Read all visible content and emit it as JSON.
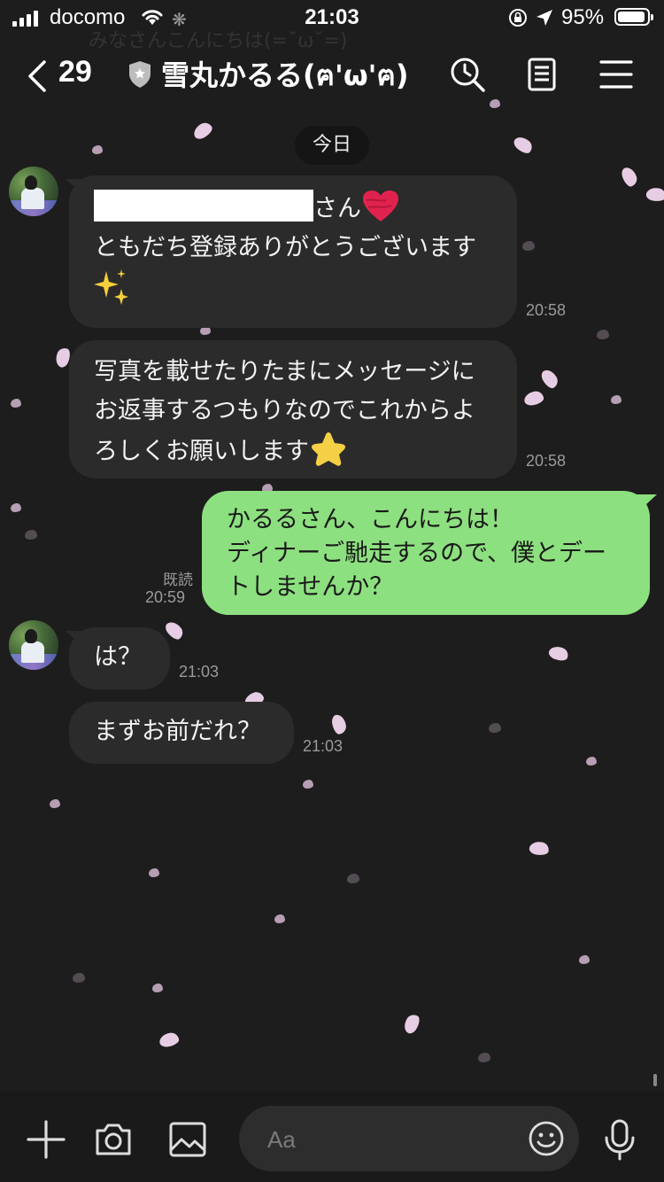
{
  "status_bar": {
    "carrier": "docomo",
    "time": "21:03",
    "battery_percent": "95%",
    "battery_level": 0.95
  },
  "ghost_notification": "みなさんこんにちは(=˘ω˘=)",
  "header": {
    "back_count": "29",
    "title": "雪丸かるる(ฅ'ω'ฅ)",
    "icons": [
      "shield-icon",
      "history-search-icon",
      "notes-icon",
      "menu-icon"
    ]
  },
  "date_label": "今日",
  "messages": [
    {
      "from": "them",
      "line1_suffix": "さん",
      "line2": "ともだち登録ありがとうございます",
      "time": "20:58"
    },
    {
      "from": "them",
      "line1": "写真を載せたりたまにメッセージに",
      "line2": "お返事するつもりなのでこれからよ",
      "line3": "ろしくお願いします",
      "time": "20:58"
    },
    {
      "from": "me",
      "line1": "かるるさん、こんにちは！",
      "line2": "ディナーご馳走するので、僕とデー",
      "line3": "トしませんか？",
      "read_label": "既読",
      "time": "20:59"
    },
    {
      "from": "them",
      "line1": "は？",
      "time": "21:03"
    },
    {
      "from": "them",
      "line1": "まずお前だれ？",
      "time": "21:03"
    }
  ],
  "input_bar": {
    "placeholder": "Aa",
    "icons": [
      "plus-icon",
      "camera-icon",
      "image-icon",
      "emoji-icon",
      "microphone-icon"
    ]
  },
  "colors": {
    "background": "#1d1d1d",
    "their_bubble": "#2b2b2b",
    "my_bubble": "#8de07f",
    "petal": "#f2d7ee"
  }
}
